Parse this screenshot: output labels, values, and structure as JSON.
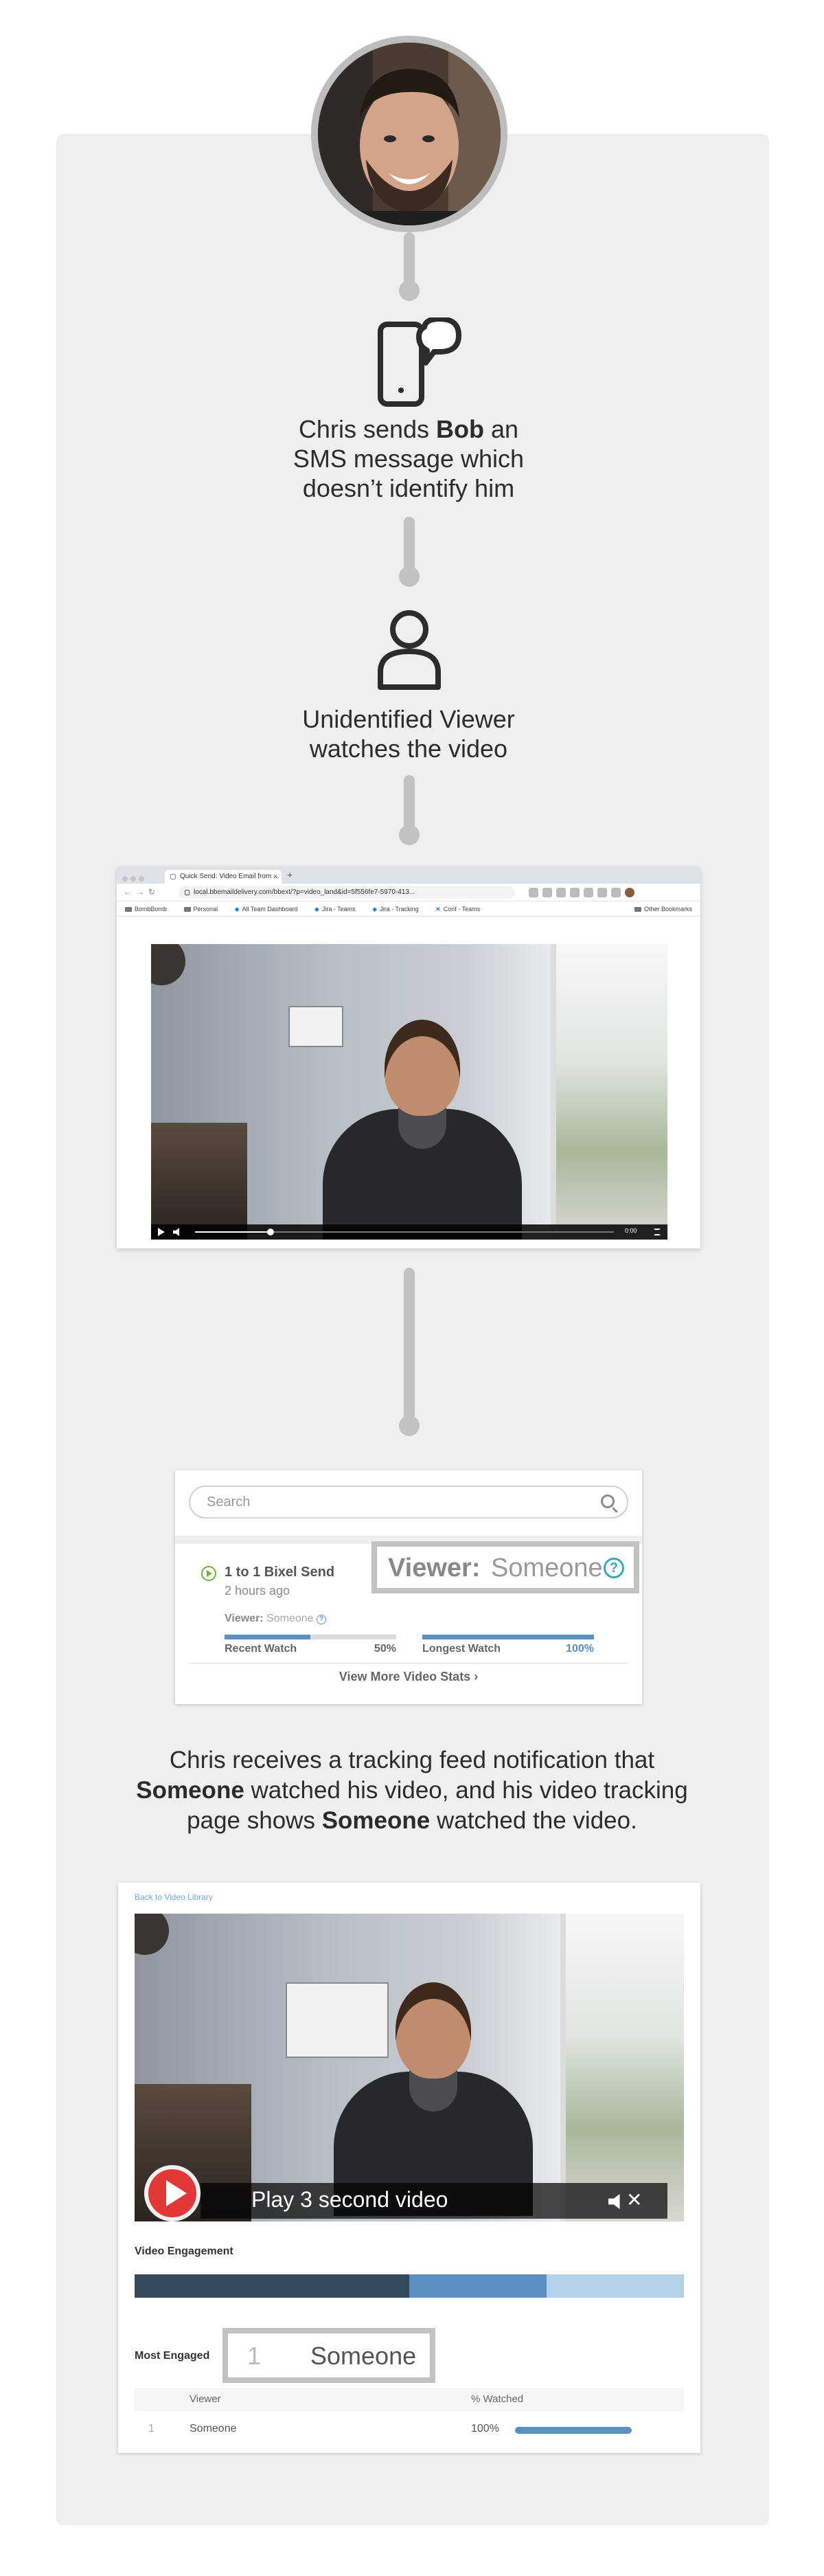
{
  "steps": {
    "sms_caption": {
      "part1": "Chris sends ",
      "bold": "Bob",
      "part2": " an SMS message which doesn’t identify him"
    },
    "viewer_caption": "Unidentified Viewer watches the video",
    "notify_caption": {
      "l1": "Chris receives a tracking feed notification that",
      "b1": "Someone",
      "l2": " watched his video, and his video tracking",
      "l3a": "page shows ",
      "b2": "Someone",
      "l3b": " watched the video."
    }
  },
  "browser": {
    "tab_title": "Quick Send: Video Email from ...",
    "tab_close": "×",
    "new_tab": "+",
    "url": "local.bbemaildelivery.com/bbext/?p=video_land&id=5f556fe7-5970-413...",
    "bookmarks": [
      "BombBomb",
      "Personal",
      "All Team Dashboard",
      "Jira - Teams",
      "Jira - Tracking",
      "Conf - Teams"
    ],
    "other_bookmarks": "Other Bookmarks",
    "video_time": "0:00",
    "progress": 0.18
  },
  "feed": {
    "search_placeholder": "Search",
    "title": "1 to 1 Bixel Send",
    "ago": "2 hours ago",
    "viewer_label": "Viewer:",
    "viewer_value": "Someone",
    "help": "?",
    "recent_label": "Recent Watch",
    "recent_value": "50%",
    "recent_fraction": 0.5,
    "longest_label": "Longest Watch",
    "longest_value": "100%",
    "longest_fraction": 1.0,
    "more_link": "View More Video Stats ›",
    "callout_label": "Viewer:",
    "callout_value": "Someone",
    "callout_help": "?"
  },
  "tracking": {
    "back_link": "Back to Video Library",
    "play_text": "Play 3 second video",
    "mute_x": "✕",
    "engagement_title": "Video Engagement",
    "engagement_segments": [
      {
        "fraction": 0.5,
        "color": "#344a5c"
      },
      {
        "fraction": 0.25,
        "color": "#5b8fc2"
      },
      {
        "fraction": 0.25,
        "color": "#b3d2e8"
      }
    ],
    "most_engaged_label": "Most Engaged",
    "callout_rank": "1",
    "callout_name": "Someone",
    "col_viewer": "Viewer",
    "col_watched": "% Watched",
    "rows": [
      {
        "rank": "1",
        "name": "Someone",
        "watched": "100%",
        "fraction": 1.0
      }
    ]
  },
  "colors": {
    "connector": "#c2c2c2",
    "accent_blue": "#5b8fc2",
    "red_play": "#e23838",
    "help_teal": "#39a9b8"
  }
}
